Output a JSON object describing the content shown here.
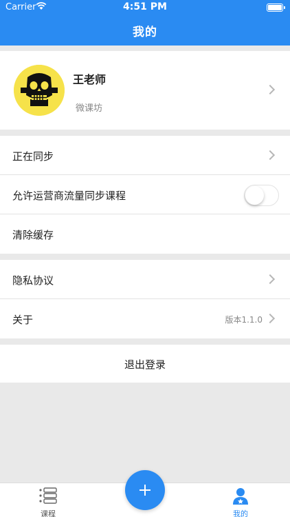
{
  "status": {
    "carrier": "Carrier",
    "time": "4:51 PM"
  },
  "header": {
    "title": "我的"
  },
  "profile": {
    "name": "王老师",
    "subtitle": "微课坊"
  },
  "settings": {
    "syncing": "正在同步",
    "allow_mobile_sync": "允许运营商流量同步课程",
    "allow_mobile_sync_on": false,
    "clear_cache": "清除缓存",
    "privacy": "隐私协议",
    "about": "关于",
    "version": "版本1.1.0"
  },
  "logout": {
    "label": "退出登录"
  },
  "tabbar": {
    "courses": "课程",
    "mine": "我的"
  },
  "colors": {
    "brand": "#2a8bf2",
    "background": "#e9e9e9"
  }
}
